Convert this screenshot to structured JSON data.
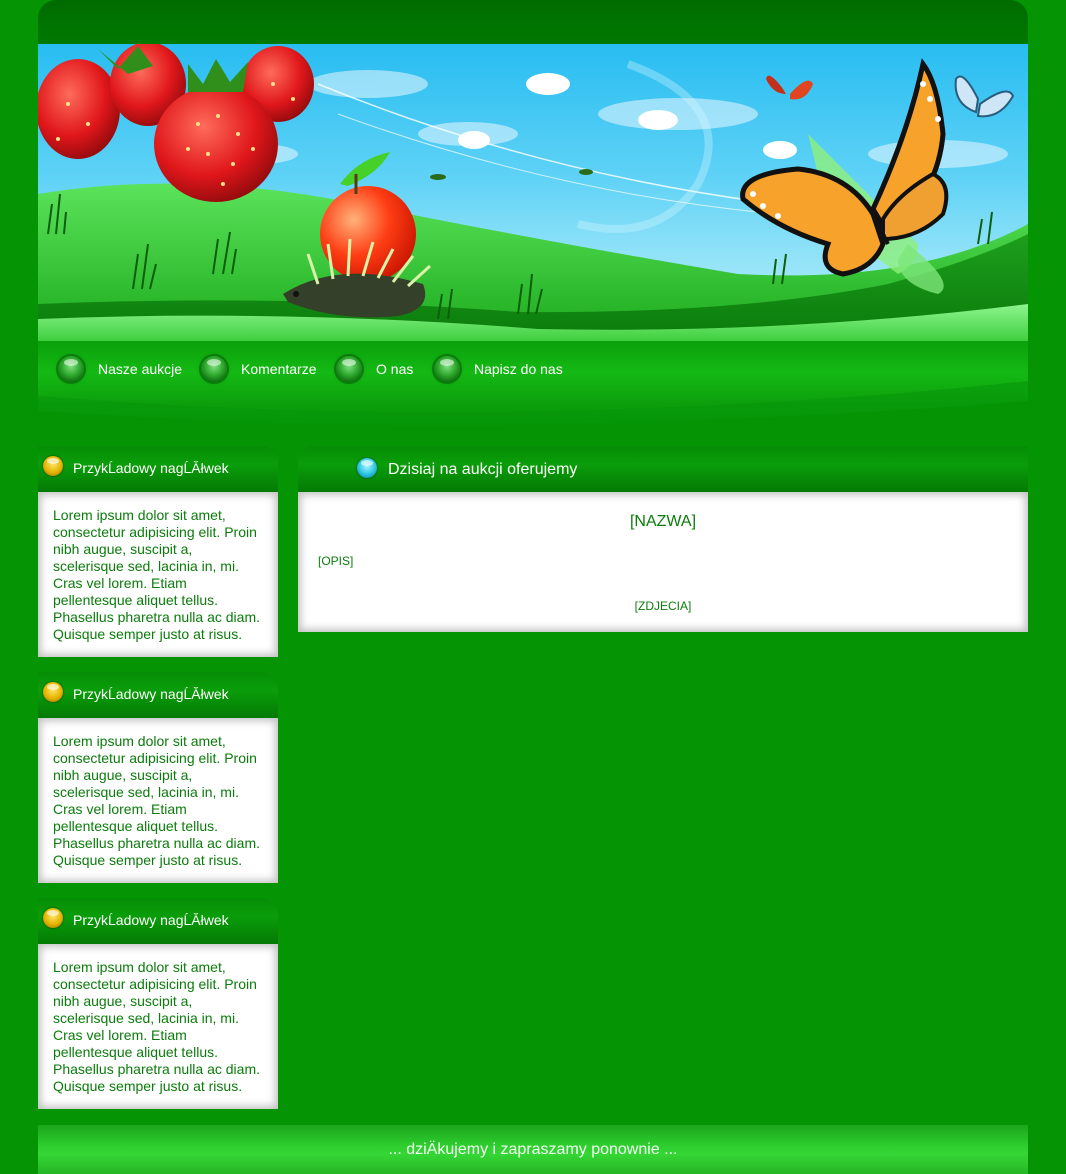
{
  "nav": {
    "items": [
      {
        "label": "Nasze aukcje"
      },
      {
        "label": "Komentarze"
      },
      {
        "label": "O nas"
      },
      {
        "label": "Napisz do nas"
      }
    ]
  },
  "sidebar": {
    "boxes": [
      {
        "title": "PrzykĹadowy nagĹĂłwek",
        "text": "Lorem ipsum dolor sit amet, consectetur adipisicing elit. Proin nibh augue, suscipit a, scelerisque sed, lacinia in, mi. Cras vel lorem. Etiam pellentesque aliquet tellus. Phasellus pharetra nulla ac diam. Quisque semper justo at risus."
      },
      {
        "title": "PrzykĹadowy nagĹĂłwek",
        "text": "Lorem ipsum dolor sit amet, consectetur adipisicing elit. Proin nibh augue, suscipit a, scelerisque sed, lacinia in, mi. Cras vel lorem. Etiam pellentesque aliquet tellus. Phasellus pharetra nulla ac diam. Quisque semper justo at risus."
      },
      {
        "title": "PrzykĹadowy nagĹĂłwek",
        "text": "Lorem ipsum dolor sit amet, consectetur adipisicing elit. Proin nibh augue, suscipit a, scelerisque sed, lacinia in, mi. Cras vel lorem. Etiam pellentesque aliquet tellus. Phasellus pharetra nulla ac diam. Quisque semper justo at risus."
      }
    ]
  },
  "main": {
    "title": "Dzisiaj na aukcji oferujemy",
    "name": "[NAZWA]",
    "description": "[OPIS]",
    "photos": "[ZDJECIA]"
  },
  "footer": {
    "text": "... dziÄkujemy i zapraszamy ponownie ..."
  },
  "banner": {
    "illustrations": [
      "strawberries",
      "apple",
      "hedgehog",
      "monarch-butterfly",
      "red-butterfly",
      "blue-butterfly",
      "clouds",
      "green-hills"
    ]
  },
  "colors": {
    "page_background": "#049404",
    "text_green": "#0b7c0b",
    "box_white": "#ffffff"
  }
}
